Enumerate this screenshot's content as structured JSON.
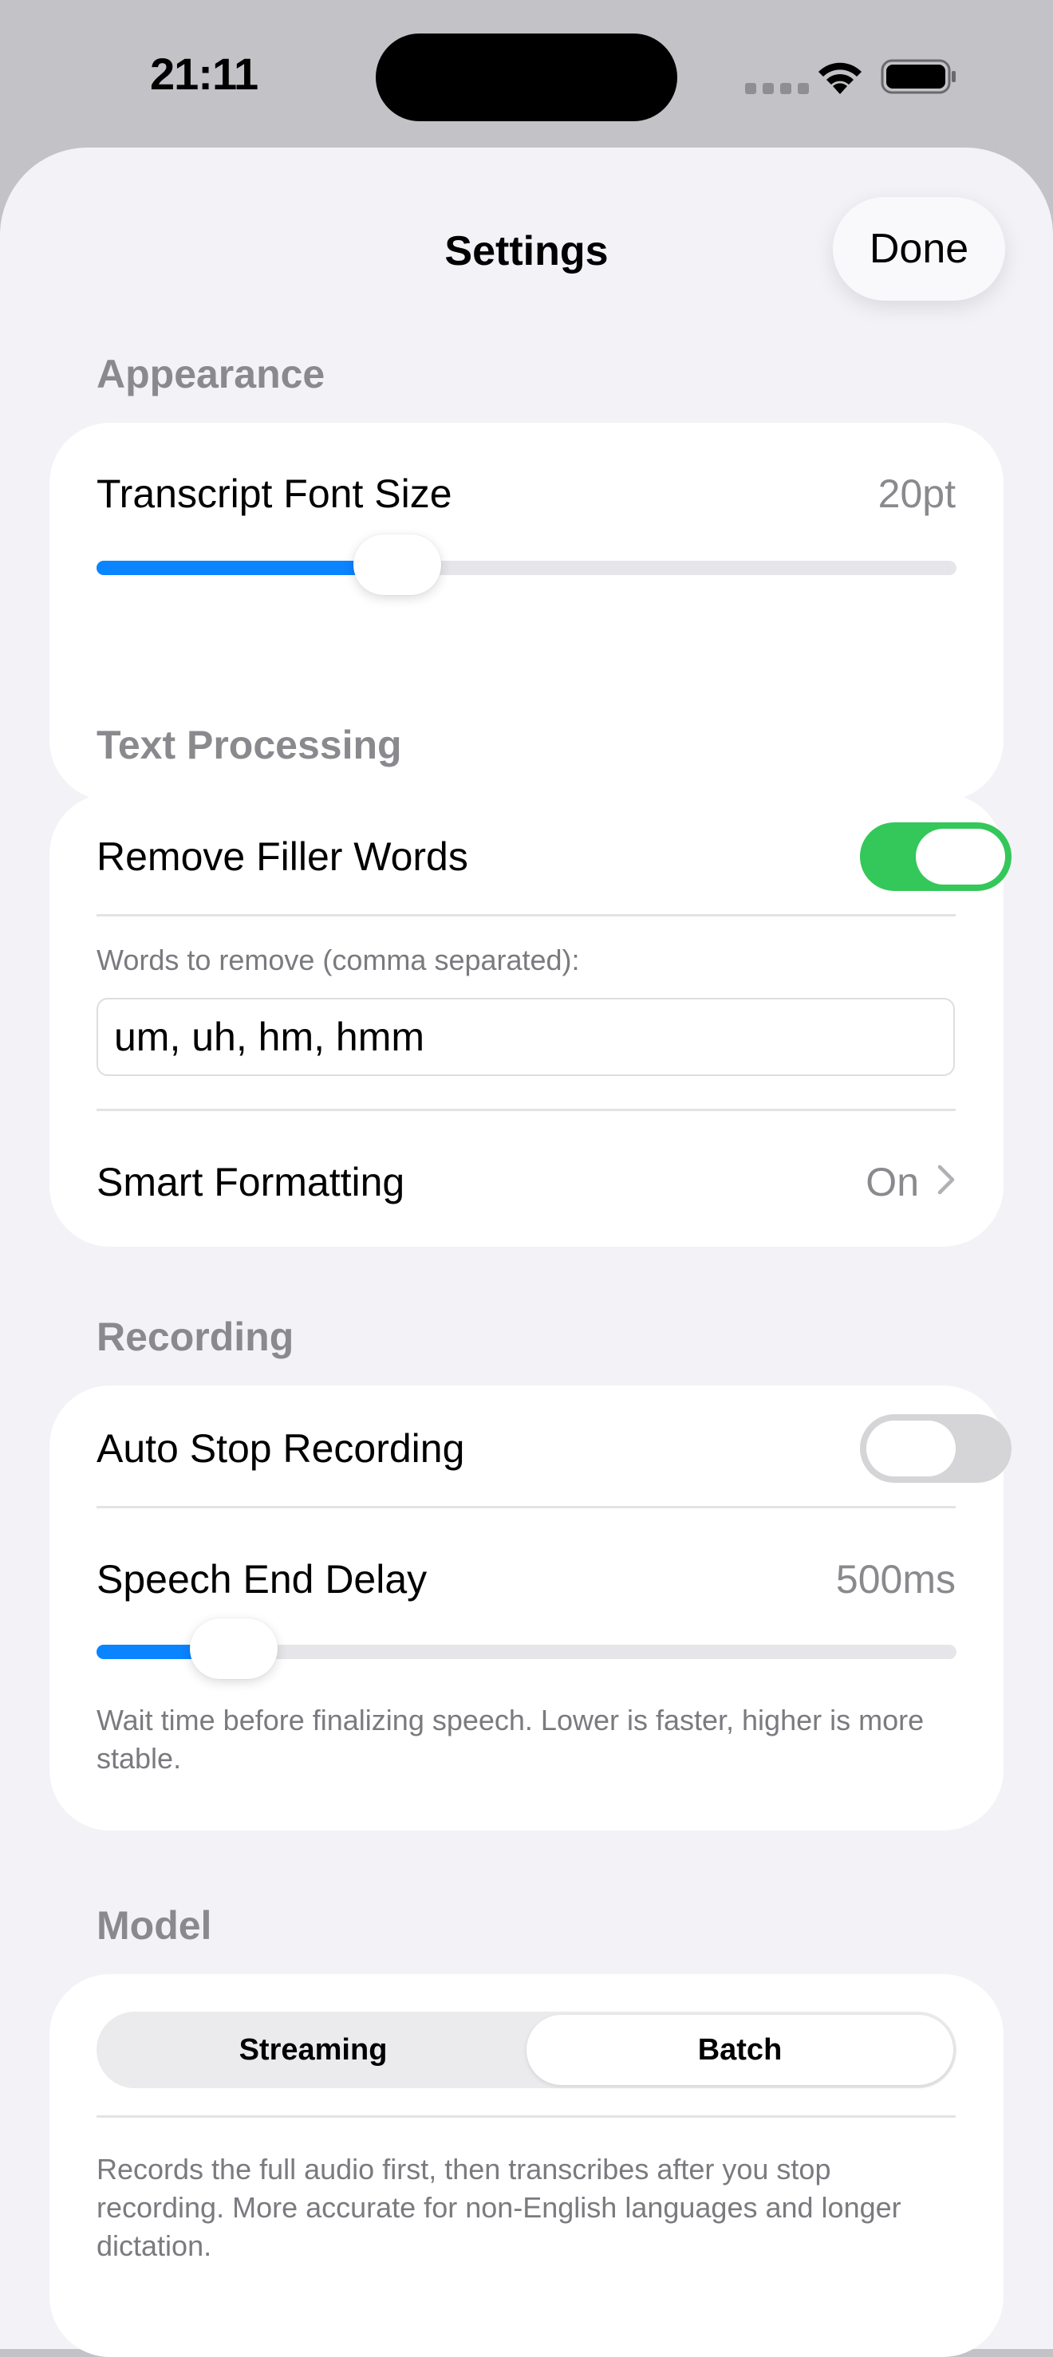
{
  "status_bar": {
    "time": "21:11",
    "wifi_icon": "wifi-icon",
    "battery_icon": "battery-icon"
  },
  "sheet": {
    "title": "Settings",
    "done_label": "Done"
  },
  "appearance": {
    "header": "Appearance",
    "font_size_label": "Transcript Font Size",
    "font_size_value": "20pt",
    "font_size_slider_fraction": 0.35
  },
  "text_processing": {
    "header": "Text Processing",
    "remove_filler_label": "Remove Filler Words",
    "remove_filler_on": true,
    "words_caption": "Words to remove (comma separated):",
    "words_value": "um, uh, hm, hmm",
    "smart_formatting_label": "Smart Formatting",
    "smart_formatting_value": "On"
  },
  "recording": {
    "header": "Recording",
    "auto_stop_label": "Auto Stop Recording",
    "auto_stop_on": false,
    "speech_delay_label": "Speech End Delay",
    "speech_delay_value": "500ms",
    "speech_delay_slider_fraction": 0.16,
    "speech_delay_caption": "Wait time before finalizing speech. Lower is faster, higher is more stable."
  },
  "model": {
    "header": "Model",
    "segments": [
      "Streaming",
      "Batch"
    ],
    "selected_segment": "Batch",
    "caption": "Records the full audio first, then transcribes after you stop recording. More accurate for non-English languages and longer dictation."
  },
  "colors": {
    "accent": "#0a84ff",
    "toggle_on": "#34c759",
    "background": "#f2f2f7"
  }
}
